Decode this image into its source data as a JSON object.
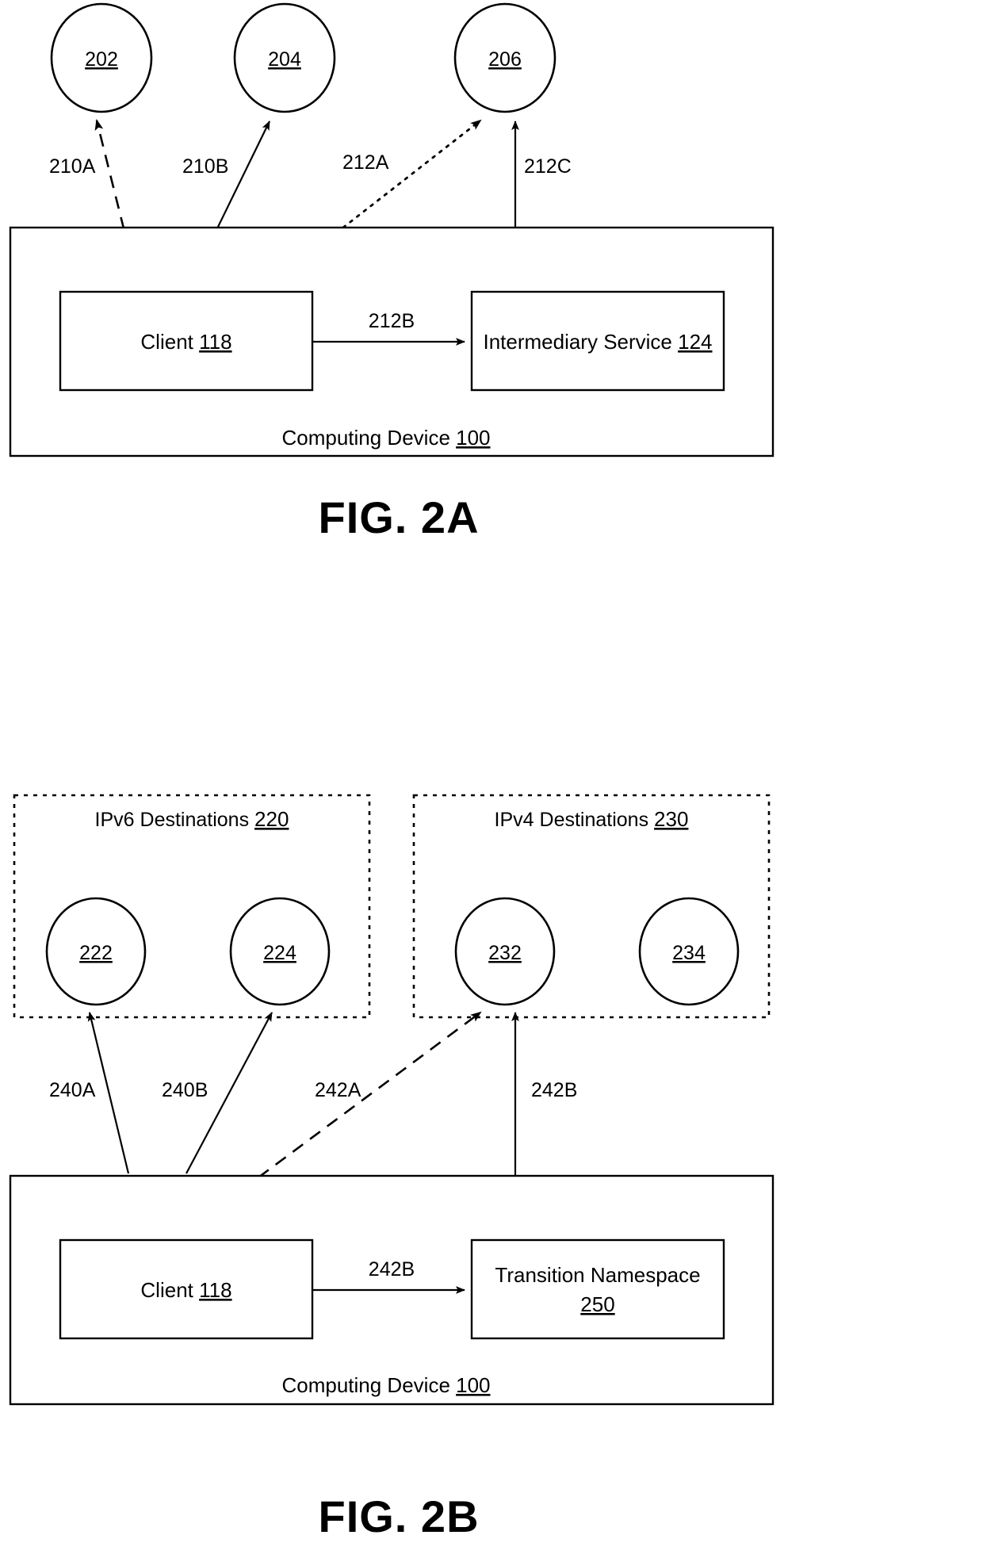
{
  "figures": [
    {
      "id": "fig2a",
      "caption": "FIG. 2A",
      "destinations": [
        {
          "ref": "202"
        },
        {
          "ref": "204"
        },
        {
          "ref": "206"
        }
      ],
      "container": {
        "label": "Computing Device",
        "ref": "100"
      },
      "blocks": [
        {
          "label": "Client",
          "ref": "118"
        },
        {
          "label": "Intermediary Service",
          "ref": "124"
        }
      ],
      "edges": [
        {
          "label": "210A",
          "style": "dashed",
          "from": "Client 118",
          "to": "202"
        },
        {
          "label": "210B",
          "style": "solid",
          "from": "Client 118",
          "to": "204"
        },
        {
          "label": "212A",
          "style": "dotted",
          "from": "Client 118",
          "to": "206"
        },
        {
          "label": "212B",
          "style": "solid",
          "from": "Client 118",
          "to": "Intermediary Service 124"
        },
        {
          "label": "212C",
          "style": "solid",
          "from": "Intermediary Service 124",
          "to": "206"
        }
      ]
    },
    {
      "id": "fig2b",
      "caption": "FIG. 2B",
      "groups": [
        {
          "label": "IPv6 Destinations",
          "ref": "220",
          "members": [
            "222",
            "224"
          ]
        },
        {
          "label": "IPv4 Destinations",
          "ref": "230",
          "members": [
            "232",
            "234"
          ]
        }
      ],
      "destinations": [
        {
          "ref": "222"
        },
        {
          "ref": "224"
        },
        {
          "ref": "232"
        },
        {
          "ref": "234"
        }
      ],
      "container": {
        "label": "Computing Device",
        "ref": "100"
      },
      "blocks": [
        {
          "label": "Client",
          "ref": "118"
        },
        {
          "label": "Transition Namespace",
          "ref": "250"
        }
      ],
      "edges": [
        {
          "label": "240A",
          "style": "solid",
          "from": "Client 118",
          "to": "222"
        },
        {
          "label": "240B",
          "style": "solid",
          "from": "Client 118",
          "to": "224"
        },
        {
          "label": "242A",
          "style": "dashed",
          "from": "Client 118",
          "to": "232"
        },
        {
          "label": "242B",
          "style": "solid",
          "from": "Client 118",
          "to": "Transition Namespace 250"
        },
        {
          "label": "242B_up",
          "style": "solid",
          "from": "Transition Namespace 250",
          "to": "232"
        }
      ]
    }
  ],
  "labels": {
    "fig2a_caption": "FIG. 2A",
    "fig2b_caption": "FIG. 2B",
    "computing_device": "Computing Device",
    "computing_device_ref": "100",
    "client": "Client",
    "client_ref": "118",
    "intermediary_service": "Intermediary Service",
    "intermediary_service_ref": "124",
    "transition_namespace": "Transition Namespace",
    "transition_namespace_ref": "250",
    "ipv6_destinations": "IPv6 Destinations",
    "ipv6_destinations_ref": "220",
    "ipv4_destinations": "IPv4 Destinations",
    "ipv4_destinations_ref": "230",
    "circle_202": "202",
    "circle_204": "204",
    "circle_206": "206",
    "circle_222": "222",
    "circle_224": "224",
    "circle_232": "232",
    "circle_234": "234",
    "edge_210A": "210A",
    "edge_210B": "210B",
    "edge_212A": "212A",
    "edge_212B": "212B",
    "edge_212C": "212C",
    "edge_240A": "240A",
    "edge_240B": "240B",
    "edge_242A": "242A",
    "edge_242B_horizontal": "242B",
    "edge_242B_vertical": "242B"
  },
  "colors": {
    "stroke": "#000000",
    "background": "#ffffff"
  }
}
